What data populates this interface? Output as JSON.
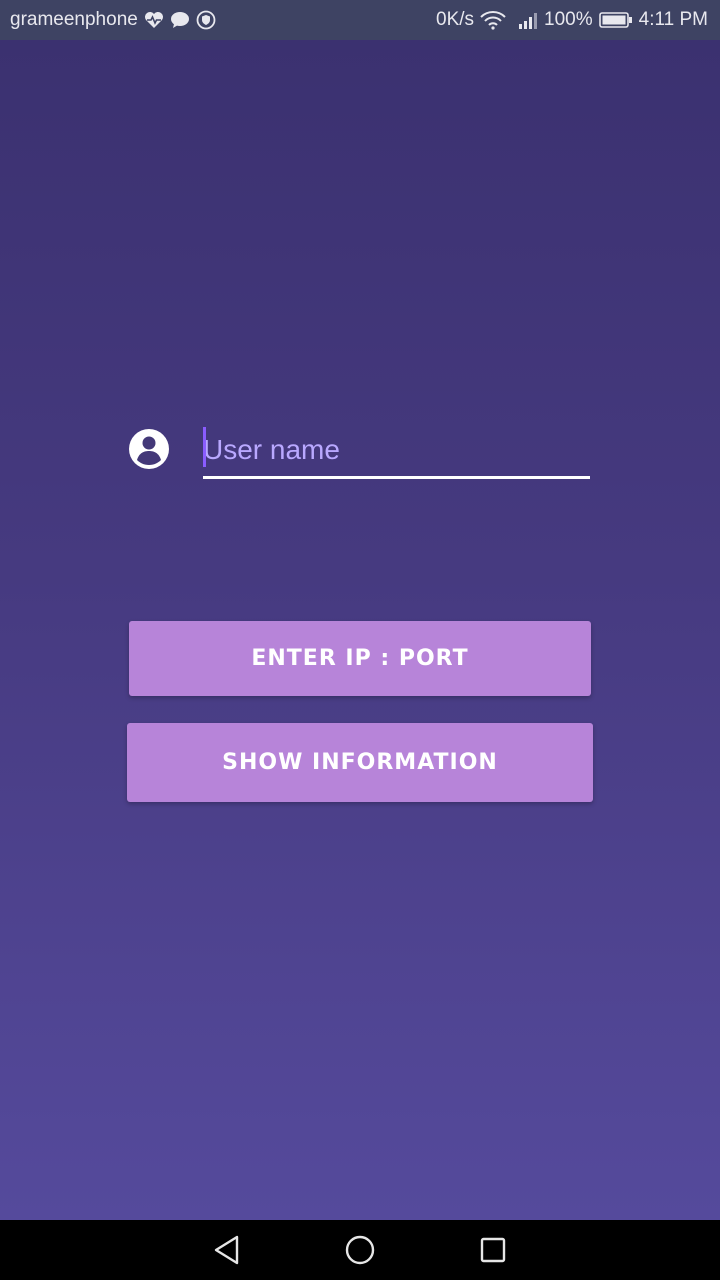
{
  "status_bar": {
    "carrier": "grameenphone",
    "network_speed": "0K/s",
    "battery_percent": "100%",
    "time": "4:11 PM",
    "icons": [
      "heartbeat-icon",
      "chat-bubble-icon",
      "vpn-shield-icon",
      "wifi-icon",
      "signal-icon",
      "battery-icon"
    ]
  },
  "login": {
    "username_placeholder": "User name",
    "username_value": "",
    "user_icon": "account-circle-icon"
  },
  "buttons": {
    "enter_ip_port": "ENTER IP : PORT",
    "show_information": "SHOW INFORMATION"
  },
  "nav_bar": {
    "icons": [
      "back-icon",
      "home-icon",
      "recent-apps-icon"
    ]
  },
  "colors": {
    "status_bar_bg": "#3e4363",
    "gradient_top": "#3b3170",
    "gradient_bottom": "#554a9c",
    "button_bg": "#b784d9",
    "placeholder": "#b9a8ff",
    "caret": "#8a5cff"
  }
}
